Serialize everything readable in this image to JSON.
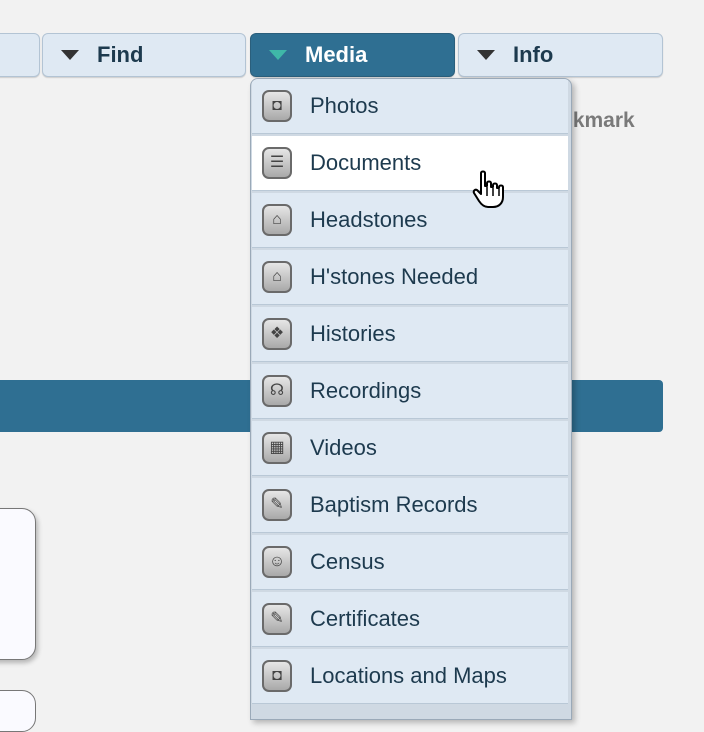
{
  "nav": {
    "tabs": [
      {
        "label": ""
      },
      {
        "label": "Find"
      },
      {
        "label": "Media"
      },
      {
        "label": "Info"
      }
    ],
    "active_tab": "Media"
  },
  "background": {
    "bookmark_fragment": "okmark"
  },
  "media_menu": {
    "items": [
      {
        "label": "Photos",
        "icon": "camera-icon",
        "glyph": "◘"
      },
      {
        "label": "Documents",
        "icon": "document-icon",
        "glyph": "☰"
      },
      {
        "label": "Headstones",
        "icon": "headstone-icon",
        "glyph": "⌂"
      },
      {
        "label": "H'stones Needed",
        "icon": "headstone-icon",
        "glyph": "⌂"
      },
      {
        "label": "Histories",
        "icon": "book-icon",
        "glyph": "❖"
      },
      {
        "label": "Recordings",
        "icon": "headphones-icon",
        "glyph": "☊"
      },
      {
        "label": "Videos",
        "icon": "film-icon",
        "glyph": "▦"
      },
      {
        "label": "Baptism Records",
        "icon": "record-icon",
        "glyph": "✎"
      },
      {
        "label": "Census",
        "icon": "people-icon",
        "glyph": "☺"
      },
      {
        "label": "Certificates",
        "icon": "certificate-icon",
        "glyph": "✎"
      },
      {
        "label": "Locations and Maps",
        "icon": "camera-icon",
        "glyph": "◘"
      }
    ],
    "hovered_item": "Documents"
  },
  "colors": {
    "accent": "#2f6f92",
    "menu_item_bg": "#dfe9f3",
    "menu_item_hover_bg": "#ffffff",
    "text": "#1d3a4e"
  }
}
